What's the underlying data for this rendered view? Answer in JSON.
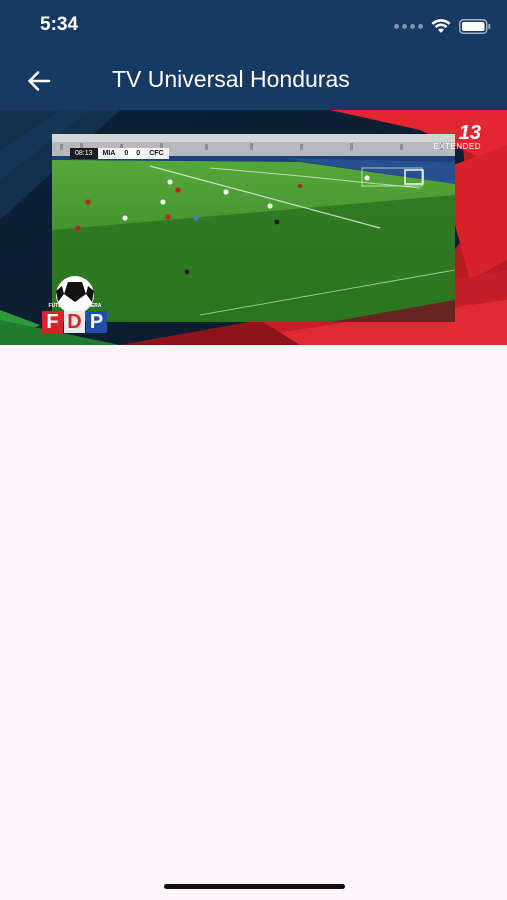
{
  "status_bar": {
    "time": "5:34",
    "icons": [
      "signal-dots-icon",
      "wifi-icon",
      "battery-icon"
    ]
  },
  "app_bar": {
    "back_icon": "arrow-left-icon",
    "title": "TV Universal Honduras"
  },
  "video": {
    "scoreboard": {
      "clock": "08:13",
      "home_team": "MIA",
      "home_score": "0",
      "away_score": "0",
      "away_team": "CFC"
    },
    "channel_bug": {
      "number": "13",
      "tag": "EXTENDED"
    },
    "logo": {
      "caption": "FÚTBOL DE PRIMERA",
      "letters": [
        "F",
        "D",
        "P"
      ]
    }
  },
  "colors": {
    "app_bar": "#163a63",
    "background": "#fcf6fb",
    "accent_red": "#d8222a",
    "pitch_green": "#3f8a2a"
  }
}
